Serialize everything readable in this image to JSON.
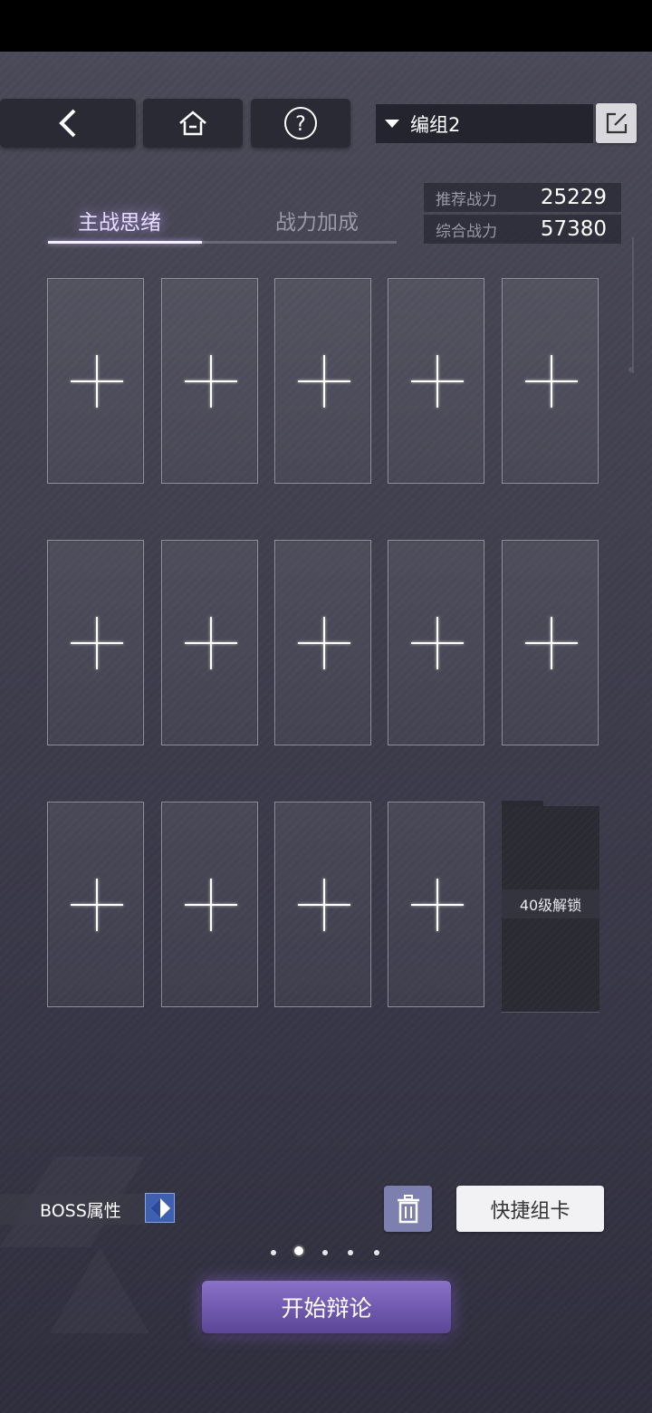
{
  "group": {
    "name": "编组2"
  },
  "tabs": [
    {
      "label": "主战思绪"
    },
    {
      "label": "战力加成"
    }
  ],
  "power": [
    {
      "label": "推荐战力",
      "value": "25229"
    },
    {
      "label": "综合战力",
      "value": "57380"
    }
  ],
  "slots": {
    "locked_label": "40级解锁"
  },
  "bottom": {
    "boss_label": "BOSS属性",
    "quick_button": "快捷组卡",
    "start_button": "开始辩论"
  },
  "pagination": {
    "total": 5,
    "active_index": 1
  },
  "colors": {
    "accent_purple": "#7a63b8",
    "trash_button": "#7d7fae",
    "boss_icon": "#3f5fb0"
  },
  "icons": [
    "back-arrow-icon",
    "home-icon",
    "help-icon",
    "dropdown-caret-icon",
    "edit-icon",
    "plus-icon",
    "diamond-icon",
    "trash-icon"
  ]
}
